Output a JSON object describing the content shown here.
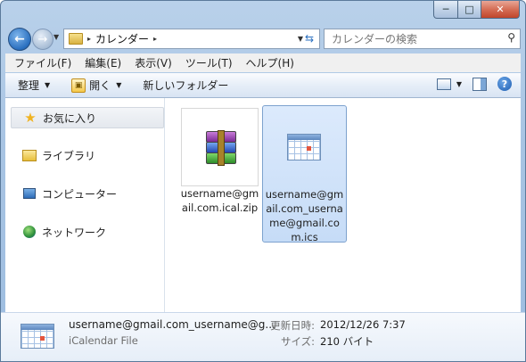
{
  "window": {
    "caption_buttons": {
      "minimize": "─",
      "maximize": "□",
      "close": "✕"
    }
  },
  "address_bar": {
    "path": "カレンダー",
    "separator_glyph": "▸"
  },
  "search": {
    "placeholder": "カレンダーの検索"
  },
  "menu": [
    "ファイル(F)",
    "編集(E)",
    "表示(V)",
    "ツール(T)",
    "ヘルプ(H)"
  ],
  "toolbar": {
    "organize": "整理",
    "open": "開く",
    "new_folder": "新しいフォルダー"
  },
  "nav_pane": {
    "items": [
      {
        "label": "お気に入り",
        "icon": "star-icon"
      },
      {
        "label": "ライブラリ",
        "icon": "library-icon"
      },
      {
        "label": "コンピューター",
        "icon": "computer-icon"
      },
      {
        "label": "ネットワーク",
        "icon": "network-icon"
      }
    ]
  },
  "files": [
    {
      "name": "username@gmail.com.ical.zip",
      "icon": "winrar-archive-icon",
      "selected": false
    },
    {
      "name": "username@gmail.com_username@gmail.com.ics",
      "icon": "calendar-icon",
      "selected": true
    }
  ],
  "details": {
    "name": "username@gmail.com_username@g...",
    "type": "iCalendar File",
    "modified_label": "更新日時:",
    "modified_value": "2012/12/26 7:37",
    "size_label": "サイズ:",
    "size_value": "210 バイト"
  },
  "colors": {
    "accent": "#2a6fbf",
    "selection": "#c6dcf7",
    "chrome": "#b9d1ea"
  }
}
